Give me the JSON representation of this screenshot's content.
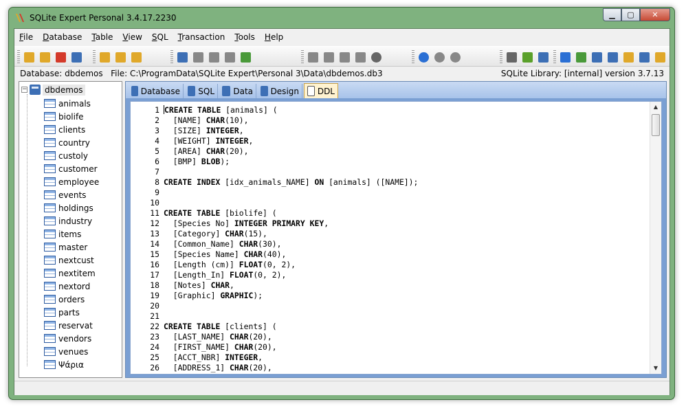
{
  "window": {
    "title": "SQLite Expert Personal 3.4.17.2230",
    "minimize_glyph": "▁",
    "maximize_glyph": "▢",
    "close_glyph": "✕"
  },
  "menu": [
    {
      "label": "File",
      "accel": "F",
      "rest": "ile"
    },
    {
      "label": "Database",
      "accel": "D",
      "rest": "atabase"
    },
    {
      "label": "Table",
      "accel": "T",
      "rest": "able"
    },
    {
      "label": "View",
      "accel": "V",
      "rest": "iew"
    },
    {
      "label": "SQL",
      "accel": "S",
      "rest": "QL"
    },
    {
      "label": "Transaction",
      "accel": "T",
      "rest": "ransaction"
    },
    {
      "label": "Tools",
      "accel": "T",
      "rest": "ools"
    },
    {
      "label": "Help",
      "accel": "H",
      "rest": "elp"
    }
  ],
  "toolbar": {
    "groups": [
      {
        "icons": [
          "open-database-icon",
          "new-database-icon",
          "close-database-icon",
          "attach-database-icon"
        ],
        "colors": [
          "#e0a82a",
          "#e0a82a",
          "#d43a2a",
          "#3d6fb5"
        ]
      },
      {
        "icons": [
          "new-table-icon",
          "design-table-icon",
          "drop-table-icon"
        ],
        "colors": [
          "#e0a82a",
          "#e0a82a",
          "#e0a82a"
        ]
      },
      {
        "icons": [
          "new-view-icon",
          "edit-view-icon",
          "refresh-icon",
          "properties-icon",
          "run-query-icon"
        ],
        "colors": [
          "#3d6fb5",
          "#888888",
          "#888888",
          "#888888",
          "#4a9a3a"
        ]
      },
      {
        "icons": [
          "new-trigger-icon",
          "edit-trigger-icon",
          "drop-trigger-icon",
          "rename-icon",
          "stop-icon"
        ],
        "colors": [
          "#888888",
          "#888888",
          "#888888",
          "#888888",
          "#666666"
        ]
      },
      {
        "icons": [
          "begin-transaction-icon",
          "commit-icon",
          "rollback-icon"
        ],
        "colors": [
          "#2a6fd4",
          "#888888",
          "#888888"
        ]
      },
      {
        "icons": [
          "settings-icon",
          "filter-icon",
          "layout-icon"
        ],
        "colors": [
          "#666666",
          "#5aa02a",
          "#3d6fb5"
        ]
      },
      {
        "icons": [
          "help-icon",
          "home-icon",
          "web-icon",
          "edit-icon",
          "mail-icon",
          "check-update-icon",
          "about-icon"
        ],
        "colors": [
          "#2a6fd4",
          "#4a9a3a",
          "#3d6fb5",
          "#3d6fb5",
          "#e0a82a",
          "#3d6fb5",
          "#e0a82a"
        ]
      }
    ]
  },
  "status": {
    "database": "Database: dbdemos",
    "file": "File: C:\\ProgramData\\SQLite Expert\\Personal 3\\Data\\dbdemos.db3",
    "library": "SQLite Library: [internal] version 3.7.13"
  },
  "tree": {
    "expander": "−",
    "root": "dbdemos",
    "tables": [
      "animals",
      "biolife",
      "clients",
      "country",
      "custoly",
      "customer",
      "employee",
      "events",
      "holdings",
      "industry",
      "items",
      "master",
      "nextcust",
      "nextitem",
      "nextord",
      "orders",
      "parts",
      "reservat",
      "vendors",
      "venues",
      "Ψάρια"
    ]
  },
  "tabs": [
    {
      "label": "Database",
      "icon": "database-tab-icon",
      "color": "#3d6fb5"
    },
    {
      "label": "SQL",
      "icon": "sql-tab-icon",
      "color": "#3d6fb5"
    },
    {
      "label": "Data",
      "icon": "data-tab-icon",
      "color": "#3d6fb5"
    },
    {
      "label": "Design",
      "icon": "design-tab-icon",
      "color": "#3d6fb5"
    },
    {
      "label": "DDL",
      "icon": "ddl-tab-icon",
      "color": "#ffffff",
      "active": true
    }
  ],
  "ddl_lines": [
    {
      "n": "1",
      "code": "CREATE TABLE [animals] ("
    },
    {
      "n": "2",
      "code": "  [NAME] CHAR(10),"
    },
    {
      "n": "3",
      "code": "  [SIZE] INTEGER,"
    },
    {
      "n": "4",
      "code": "  [WEIGHT] INTEGER,"
    },
    {
      "n": "5",
      "code": "  [AREA] CHAR(20),"
    },
    {
      "n": "6",
      "code": "  [BMP] BLOB);"
    },
    {
      "n": "7",
      "code": ""
    },
    {
      "n": "8",
      "code": "CREATE INDEX [idx_animals_NAME] ON [animals] ([NAME]);"
    },
    {
      "n": "9",
      "code": ""
    },
    {
      "n": "10",
      "code": ""
    },
    {
      "n": "11",
      "code": "CREATE TABLE [biolife] ("
    },
    {
      "n": "12",
      "code": "  [Species No] INTEGER PRIMARY KEY,"
    },
    {
      "n": "13",
      "code": "  [Category] CHAR(15),"
    },
    {
      "n": "14",
      "code": "  [Common_Name] CHAR(30),"
    },
    {
      "n": "15",
      "code": "  [Species Name] CHAR(40),"
    },
    {
      "n": "16",
      "code": "  [Length (cm)] FLOAT(0, 2),"
    },
    {
      "n": "17",
      "code": "  [Length_In] FLOAT(0, 2),"
    },
    {
      "n": "18",
      "code": "  [Notes] CHAR,"
    },
    {
      "n": "19",
      "code": "  [Graphic] GRAPHIC);"
    },
    {
      "n": "20",
      "code": ""
    },
    {
      "n": "21",
      "code": ""
    },
    {
      "n": "22",
      "code": "CREATE TABLE [clients] ("
    },
    {
      "n": "23",
      "code": "  [LAST_NAME] CHAR(20),"
    },
    {
      "n": "24",
      "code": "  [FIRST_NAME] CHAR(20),"
    },
    {
      "n": "25",
      "code": "  [ACCT_NBR] INTEGER,"
    },
    {
      "n": "26",
      "code": "  [ADDRESS_1] CHAR(20),"
    }
  ],
  "scrollbar": {
    "up_glyph": "▲",
    "down_glyph": "▼"
  }
}
